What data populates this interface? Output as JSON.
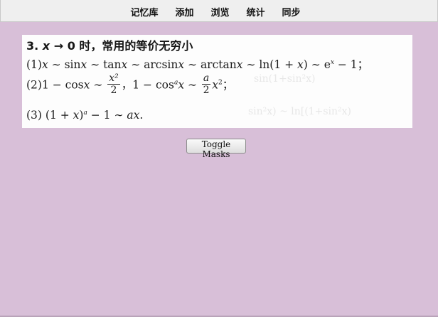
{
  "nav": {
    "items": [
      {
        "label": "记忆库"
      },
      {
        "label": "添加"
      },
      {
        "label": "浏览"
      },
      {
        "label": "统计"
      },
      {
        "label": "同步"
      }
    ]
  },
  "card": {
    "heading": {
      "number": "3.",
      "var": "x",
      "arrow": "→",
      "zero": "0",
      "text": "时，常用的等价无穷小"
    },
    "line1": {
      "index": "(1)",
      "x": "x",
      "sim": " ∼ ",
      "sin": "sin",
      "tan": "tan",
      "arcsin": "arcsin",
      "arctan": "arctan",
      "ln_open": "ln(1 + ",
      "ln_close": ")",
      "e": "e",
      "exp": "x",
      "minus_one": " − 1；"
    },
    "line2": {
      "index": "(2)",
      "one_minus": "1 − ",
      "cos": "cos",
      "x": "x",
      "sim": " ∼ ",
      "frac1_num": "x²",
      "frac1_den": "2",
      "comma": "，",
      "cos_pow": "a",
      "frac2_num": "a",
      "frac2_den": "2",
      "x2": "x",
      "sq": "2",
      "end": "；"
    },
    "line3": {
      "index": "(3)",
      "open": " (1 + ",
      "x": "x",
      "close": ")",
      "pow": "a",
      "minus_one": " − 1",
      "sim": " ∼ ",
      "ax": "ax",
      "end": "."
    }
  },
  "toggle_button": {
    "label": "Toggle Masks"
  }
}
